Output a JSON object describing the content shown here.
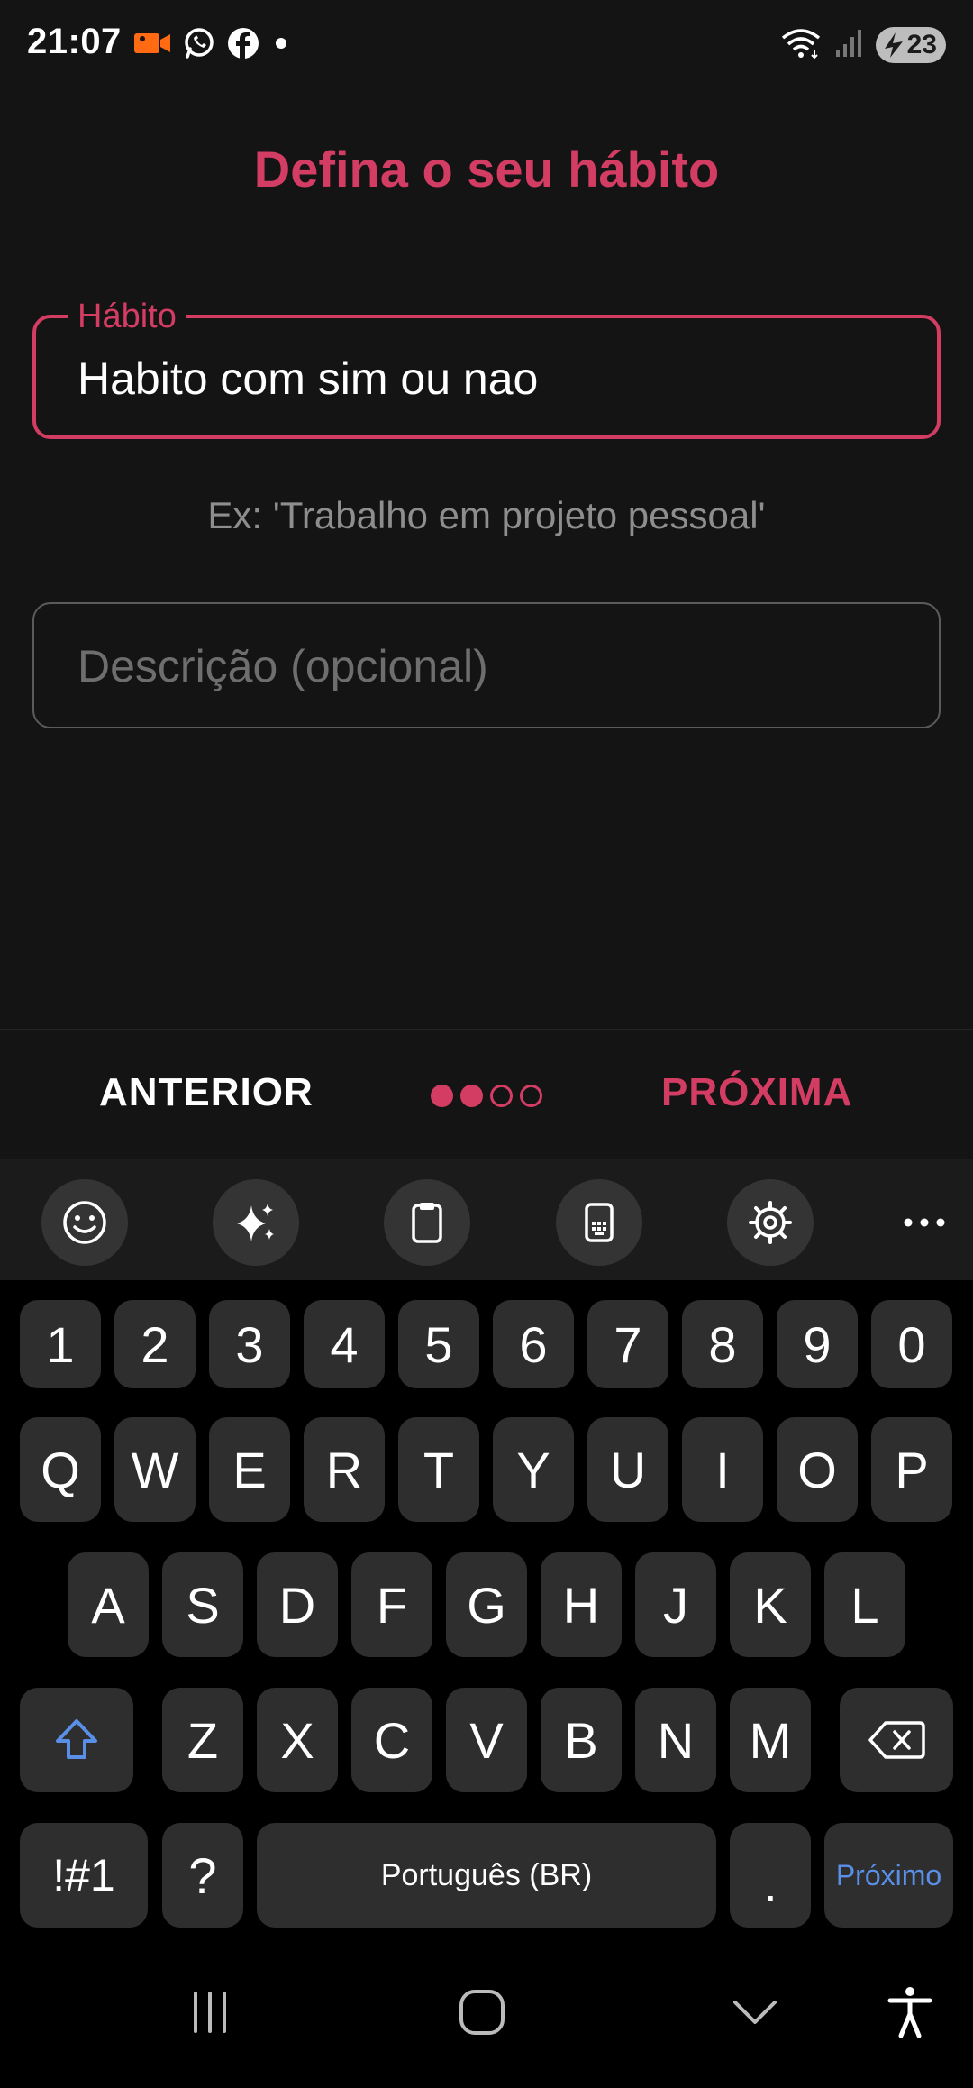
{
  "status_bar": {
    "time": "21:07",
    "left_icons": [
      "video-camera-icon",
      "whatsapp-icon",
      "facebook-icon",
      "dot-icon"
    ],
    "right_icons": [
      "wifi-icon",
      "signal-icon"
    ],
    "battery_level": "23"
  },
  "page": {
    "title": "Defina o seu hábito",
    "habit_label": "Hábito",
    "habit_value": "Habito com sim ou nao",
    "hint": "Ex: 'Trabalho em projeto pessoal'",
    "description_placeholder": "Descrição (opcional)"
  },
  "stepper": {
    "prev_label": "ANTERIOR",
    "next_label": "PRÓXIMA",
    "total_steps": 4,
    "current_step": 2
  },
  "keyboard": {
    "toolbar": [
      "emoji-icon",
      "ai-sparkle-icon",
      "clipboard-icon",
      "one-handed-keyboard-icon",
      "settings-icon",
      "more-icon"
    ],
    "row_numbers": [
      "1",
      "2",
      "3",
      "4",
      "5",
      "6",
      "7",
      "8",
      "9",
      "0"
    ],
    "row_1": [
      "Q",
      "W",
      "E",
      "R",
      "T",
      "Y",
      "U",
      "I",
      "O",
      "P"
    ],
    "row_2": [
      "A",
      "S",
      "D",
      "F",
      "G",
      "H",
      "J",
      "K",
      "L"
    ],
    "row_3": [
      "Z",
      "X",
      "C",
      "V",
      "B",
      "N",
      "M"
    ],
    "symbols_key": "!#1",
    "question_key": "?",
    "space_label": "Português (BR)",
    "period_key": ".",
    "action_label": "Próximo"
  },
  "colors": {
    "accent": "#d33c63",
    "background": "#141414",
    "keyboard_bg": "#000000",
    "key_bg": "#2e2e2e",
    "action_blue": "#5a8fe8"
  }
}
